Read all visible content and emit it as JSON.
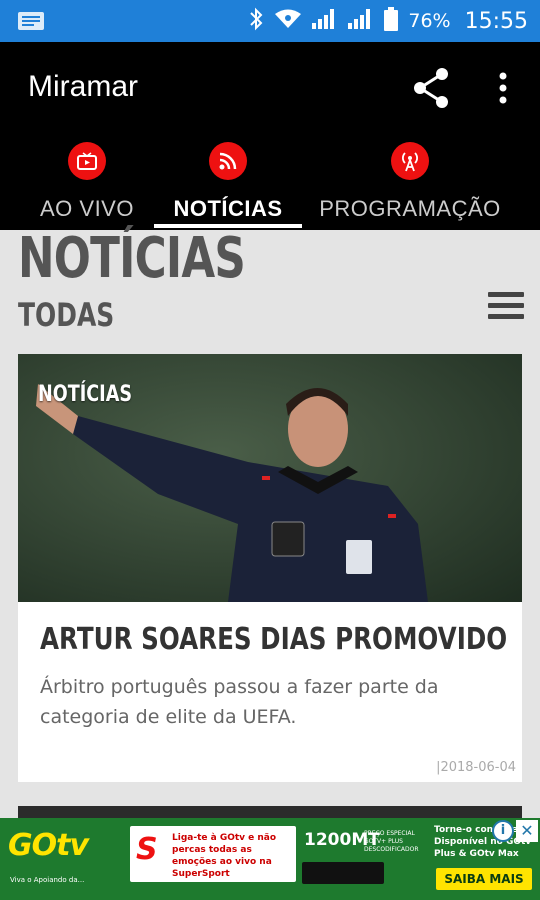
{
  "status_bar": {
    "battery": "76%",
    "time": "15:55",
    "icons": [
      "notification-icon",
      "bluetooth-icon",
      "wifi-icon",
      "signal-icon",
      "signal-icon",
      "battery-icon"
    ]
  },
  "app": {
    "title": "Miramar",
    "actions": [
      "share-icon",
      "more-vert-icon"
    ]
  },
  "tabs": [
    {
      "label": "AO VIVO",
      "icon": "live-tv-icon",
      "active": false
    },
    {
      "label": "NOTÍCIAS",
      "icon": "rss-feed-icon",
      "active": true
    },
    {
      "label": "PROGRAMAÇÃO",
      "icon": "radio-tower-icon",
      "active": false
    }
  ],
  "page": {
    "section_title": "NOTÍCIAS",
    "filter": "TODAS"
  },
  "articles": [
    {
      "tag": "NOTÍCIAS",
      "headline": "ARTUR SOARES DIAS PROMOVIDO",
      "summary": "Árbitro português passou a fazer parte da categoria de elite da UEFA.",
      "date": "|2018-06-04"
    }
  ],
  "ad": {
    "brand": "GOtv",
    "brand_sub": "Viva o Apoiando da...",
    "s_logo": "S",
    "message": "Liga-te à GOtv e não percas todas as emoções ao vivo na SuperSport",
    "price": "1200MT",
    "promo": "PREÇO ESPECIAL GOTV+ PLUS DESCODIFICADOR",
    "right_text": "Torne-o confiável Disponível no GOtv Plus & GOtv Max",
    "cta": "SAIBA MAIS",
    "info_glyph": "i",
    "close_glyph": "✕"
  },
  "colors": {
    "status_bar": "#1f80d8",
    "app_bar": "#000000",
    "tab_icon_bg": "#e11111",
    "background": "#e4e4e4",
    "ad_green": "#1e7a2e",
    "ad_yellow": "#ffe400"
  }
}
